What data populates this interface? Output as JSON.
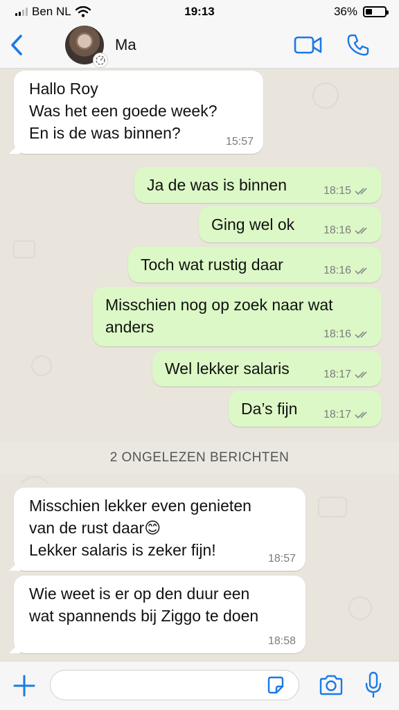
{
  "status_bar": {
    "carrier": "Ben NL",
    "time": "19:13",
    "battery": "36%",
    "battery_level": 0.36
  },
  "header": {
    "contact_name": "Ma"
  },
  "messages": [
    {
      "direction": "in",
      "text": "Hallo Roy\nWas het een goede week?\nEn is de was binnen?",
      "time": "15:57"
    },
    {
      "direction": "out",
      "text": "Ja de was is binnen",
      "time": "18:15"
    },
    {
      "direction": "out",
      "text": "Ging wel ok",
      "time": "18:16"
    },
    {
      "direction": "out",
      "text": "Toch wat rustig daar",
      "time": "18:16"
    },
    {
      "direction": "out",
      "text": "Misschien nog op zoek naar wat\nanders",
      "time": "18:16"
    },
    {
      "direction": "out",
      "text": "Wel lekker salaris",
      "time": "18:17"
    },
    {
      "direction": "out",
      "text": "Da’s fijn",
      "time": "18:17"
    },
    {
      "direction": "in",
      "text": "Misschien lekker even genieten\nvan de rust daar😊\nLekker salaris is zeker fijn!",
      "time": "18:57"
    },
    {
      "direction": "in",
      "text": "Wie weet is er op den duur een\nwat spannends bij Ziggo te doen",
      "time": "18:58"
    }
  ],
  "unread_banner": "2 ONGELEZEN BERICHTEN",
  "colors": {
    "accent": "#1a7ae6",
    "outgoing_bubble": "#dbf8c6",
    "incoming_bubble": "#ffffff",
    "read_ticks": "#8e8e8e"
  },
  "icons": [
    "back-chevron-icon",
    "video-call-icon",
    "phone-icon",
    "plus-icon",
    "sticker-icon",
    "camera-icon",
    "microphone-icon"
  ]
}
